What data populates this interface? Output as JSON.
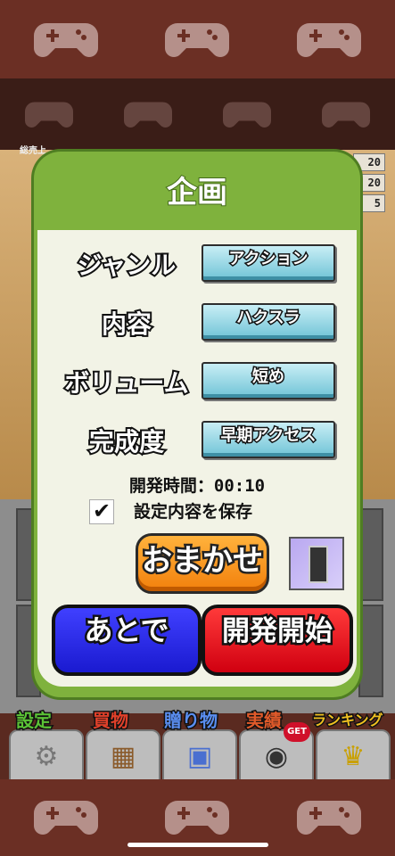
{
  "background": {
    "pad_icon": "gamepad-icon",
    "stat_label": "総売上",
    "stats": [
      "20",
      "20",
      "5"
    ]
  },
  "dialog": {
    "title": "企画",
    "rows": [
      {
        "label": "ジャンル",
        "value": "アクション"
      },
      {
        "label": "内容",
        "value": "ハクスラ"
      },
      {
        "label": "ボリューム",
        "value": "短め"
      },
      {
        "label": "完成度",
        "value": "早期アクセス"
      }
    ],
    "dev_time": "開発時間：00:10",
    "save_settings_label": "設定内容を保存",
    "save_settings_checked": true,
    "omakase_label": "おまかせ",
    "later_label": "あとで",
    "start_label": "開発開始"
  },
  "tabs": [
    {
      "label": "設定",
      "icon": "gear-icon"
    },
    {
      "label": "買物",
      "icon": "shop-icon"
    },
    {
      "label": "贈り物",
      "icon": "gift-icon"
    },
    {
      "label": "実績",
      "icon": "controller-icon",
      "badge": "GET"
    },
    {
      "label": "ランキング",
      "icon": "trophy-icon"
    }
  ],
  "colors": {
    "dialog_green": "#7fb23d",
    "bar_brown": "#6b2f24",
    "omakase_orange": "#f2800c",
    "later_blue": "#1a1ad0",
    "start_red": "#d00010"
  }
}
